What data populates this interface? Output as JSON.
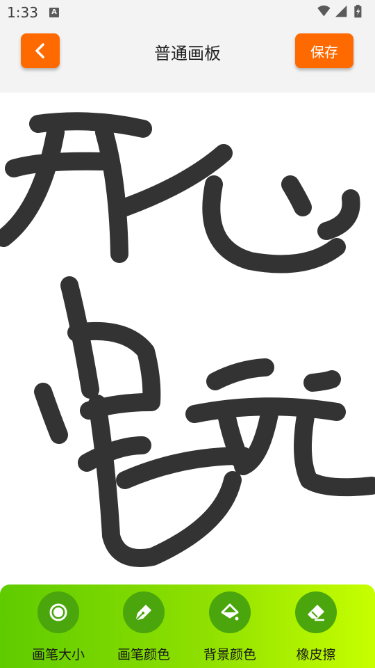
{
  "status_bar": {
    "time": "1:33",
    "notification_letter": "A"
  },
  "header": {
    "title": "普通画板",
    "save_label": "保存"
  },
  "toolbar": {
    "items": [
      {
        "label": "画笔大小",
        "icon": "brush-size-icon"
      },
      {
        "label": "画笔颜色",
        "icon": "pen-icon"
      },
      {
        "label": "背景颜色",
        "icon": "paint-bucket-icon"
      },
      {
        "label": "橡皮擦",
        "icon": "eraser-icon"
      }
    ]
  },
  "canvas": {
    "stroke_color": "#333333",
    "background": "#ffffff"
  },
  "colors": {
    "accent": "#ff6a00",
    "toolbar_start": "#5fcb00",
    "toolbar_end": "#c7ff00"
  }
}
